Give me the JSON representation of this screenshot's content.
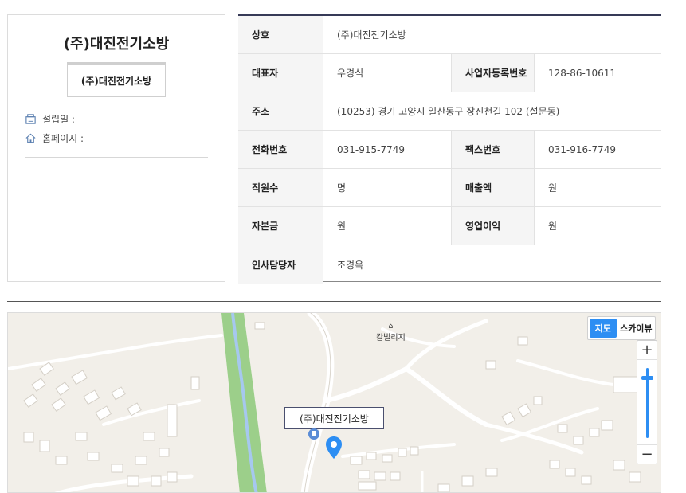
{
  "company": {
    "name": "(주)대진전기소방",
    "logo_text": "(주)대진전기소방",
    "meta": [
      {
        "icon": "building-icon",
        "label": "설립일 :"
      },
      {
        "icon": "home-icon",
        "label": "홈페이지 :"
      }
    ]
  },
  "info": {
    "rows": [
      {
        "h1": "상호",
        "v1": "(주)대진전기소방"
      },
      {
        "h1": "대표자",
        "v1": "우경식",
        "h2": "사업자등록번호",
        "v2": "128-86-10611"
      },
      {
        "h1": "주소",
        "v1": "(10253) 경기 고양시 일산동구 장진천길 102 (설문동)"
      },
      {
        "h1": "전화번호",
        "v1": "031-915-7749",
        "h2": "팩스번호",
        "v2": "031-916-7749"
      },
      {
        "h1": "직원수",
        "v1": "명",
        "h2": "매출액",
        "v2": "원"
      },
      {
        "h1": "자본금",
        "v1": "원",
        "h2": "영업이익",
        "v2": "원"
      },
      {
        "h1": "인사담당자",
        "v1": "조경옥"
      }
    ]
  },
  "map": {
    "type_buttons": {
      "map": "지도",
      "skyview": "스카이뷰"
    },
    "zoom_in": "+",
    "zoom_out": "−",
    "marker_label": "(주)대진전기소방",
    "place_label": "칼빌리지",
    "colors": {
      "ground": "#f2efe9",
      "park": "#9ccf8a",
      "river": "#a6c8ef",
      "accent": "#2d8ef3"
    }
  }
}
